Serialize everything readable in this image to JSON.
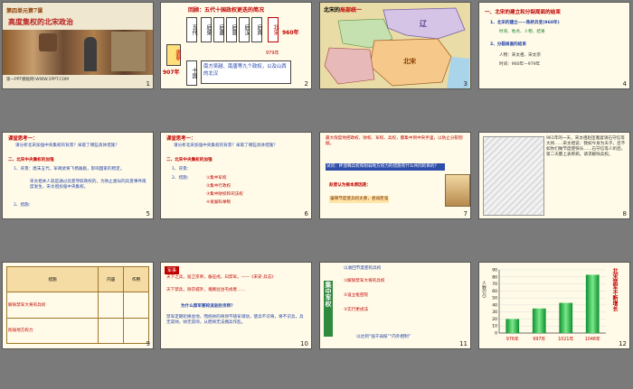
{
  "slides": [
    {
      "num": "1",
      "title": "高度集权的北宋政治",
      "unit": "第四单元第7课",
      "footer": "第一PPT模板网-WWW.1PPT.COM"
    },
    {
      "num": "2",
      "heading": "回顾：五代十国政权更迭的简况",
      "dynasties": [
        "后梁",
        "后唐",
        "后晋",
        "后汉",
        "后周"
      ],
      "left_top": "五代",
      "left_mid": "唐朝",
      "left_year": "907年",
      "left_bottom": "十国",
      "song": "北宋",
      "year_960": "960年",
      "year_979": "979年",
      "ten_kingdoms": "南方吴越、南唐等九个政权，以及山西的北汉"
    },
    {
      "num": "3",
      "map_title": "北宋的",
      "map_title_red": "局部统一",
      "label_liao": "辽",
      "label_song": "北宋"
    },
    {
      "num": "4",
      "heading": "一、北宋的建立和分裂局面的结束",
      "item1": "1、北宋的建立——陈桥兵变(960年)",
      "item1_sub": "时间、地点、人物、结果",
      "item2": "2、分裂局面的结束",
      "item2_a": "人物：宋太祖、宋太宗",
      "item2_b": "时间：960年—979年"
    },
    {
      "num": "5",
      "think": "课堂思考一：",
      "q": "请分析北宋加强中央集权的背景？采取了哪些具体措施？",
      "sec": "二、北宋中央集权的加强",
      "p1": "1、背景：唐末五代，军阀武将飞扬跋扈，影响国家的稳定。",
      "p2": "宋太祖本人就是通过兵变夺取政权的，为防止类似的兵变事件再度发生，宋太祖加强中央集权。",
      "p3": "2、措施："
    },
    {
      "num": "6",
      "think": "课堂思考一：",
      "q": "请分析北宋加强中央集权的背景？采取了哪些具体措施？",
      "sec": "二、北宋中央集权的加强",
      "p1": "1、背景：",
      "p2": "2、措施：",
      "m": [
        "①集中军权",
        "②集中行政权",
        "③集中财权和司法权",
        "④发展科举制"
      ]
    },
    {
      "num": "7",
      "text": "最大限度地把政权、财权、军权、兵权，都集中到中央手里，以防止分裂割据。",
      "q": "试问：杯酒释兵权和削弱地方权力的措施有什么共同的目的？",
      "a": "赵普认为根本原因是：",
      "a2": "藩镇节度使兵权太重，君弱臣强"
    },
    {
      "num": "8",
      "text": "961年的一天，宋太祖赵匡胤宴请石守信等大将……宋太祖说：我如今身为天子，还不如你们做节度使快乐……石守信等人听后，第二天都上表称病，请求解除兵权。"
    },
    {
      "num": "9",
      "h": [
        "措施",
        "内容",
        "作用"
      ],
      "row1": "解除禁军大将的兵权",
      "row2": "削弱地方权力"
    },
    {
      "num": "10",
      "tag": "军事",
      "quote": "天下之兵，宿卫京师，备征戍，曰禁军。——《宋史·兵志》",
      "quote2": "天下禁兵，除京城外，诸路驻泊屯戍者……",
      "q": "为什么禁军要轮流驻防京师？",
      "a": "禁军定期轮换驻地，而统帅的将领不随军调动，使兵不识将，将不识兵，兵无常帅，帅无常师，从而将无法拥兵作乱。"
    },
    {
      "num": "11",
      "side": "集中军权",
      "t1": "以收回节度使的兵权",
      "t2": "①解除禁军大将的兵权",
      "t3": "②设立枢密院",
      "t4": "③实行更戍法",
      "t5": "以达到“强干弱枝”“内外相制”"
    },
    {
      "num": "12",
      "side": "北宋禁军不断增长",
      "ylabel": "人数(万)"
    }
  ],
  "chart_data": {
    "type": "bar",
    "categories": [
      "976年",
      "997年",
      "1021年",
      "1048年"
    ],
    "values": [
      20,
      35,
      43,
      83
    ],
    "ylim": [
      0,
      90
    ],
    "yticks": [
      0,
      10,
      20,
      30,
      40,
      50,
      60,
      70,
      80,
      90
    ],
    "ylabel": "人数(万)",
    "title": "",
    "colors": {
      "bar": "#22b33c"
    }
  }
}
